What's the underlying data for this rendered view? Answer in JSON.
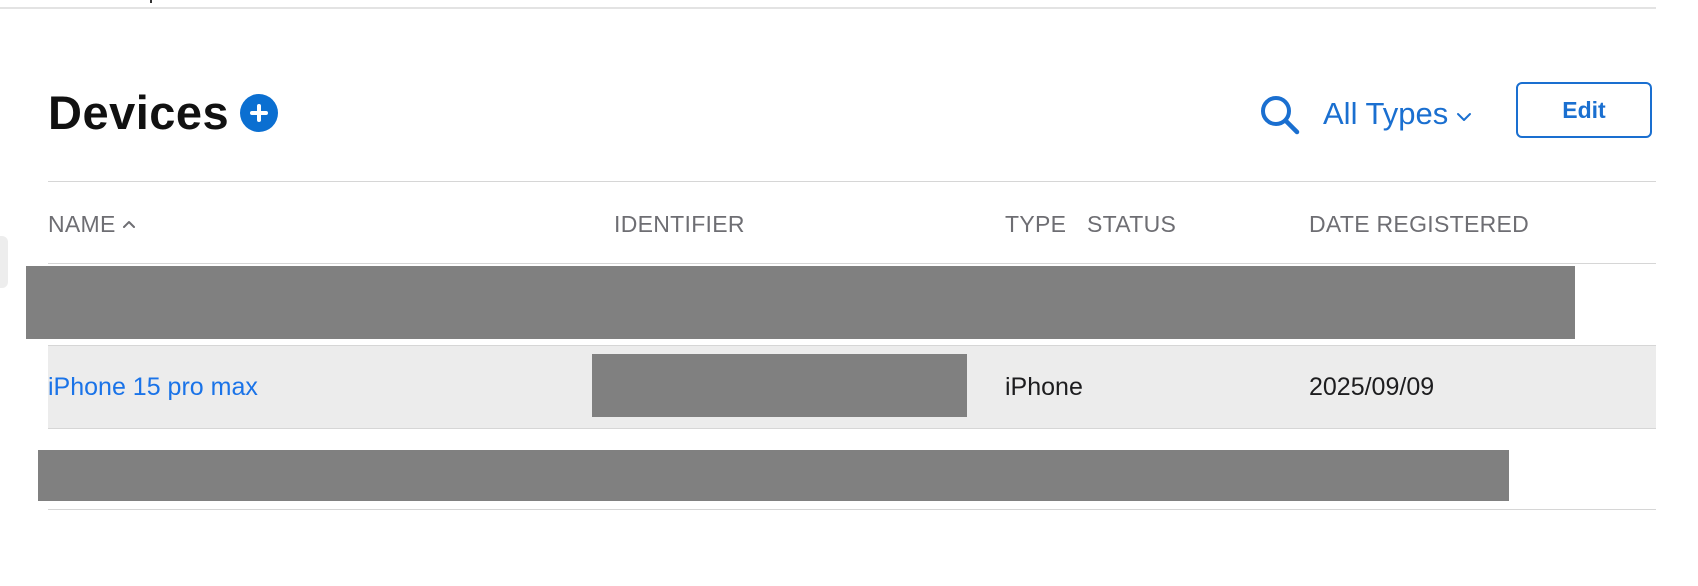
{
  "header": {
    "title": "Devices",
    "filter_label": "All Types",
    "edit_label": "Edit"
  },
  "icons": {
    "add": "plus-circle-icon",
    "search": "search-icon",
    "filter_chevron": "chevron-down-icon",
    "sort": "chevron-up-icon"
  },
  "colors": {
    "accent": "#1a6fd0",
    "add_button": "#0b6fd1",
    "link": "#1a73e8",
    "header_text": "#6e6e73",
    "row_highlight": "#ececec",
    "redaction": "#808080"
  },
  "table": {
    "columns": {
      "name": "NAME",
      "identifier": "IDENTIFIER",
      "type": "TYPE",
      "status": "STATUS",
      "date_registered": "DATE REGISTERED"
    },
    "sorted_by": "NAME",
    "sort_direction": "ascending",
    "rows": [
      {
        "redacted": true
      },
      {
        "name": "iPhone 15 pro max",
        "identifier_redacted": true,
        "type": "iPhone",
        "status": "",
        "date_registered": "2025/09/09"
      },
      {
        "redacted": true
      }
    ]
  }
}
